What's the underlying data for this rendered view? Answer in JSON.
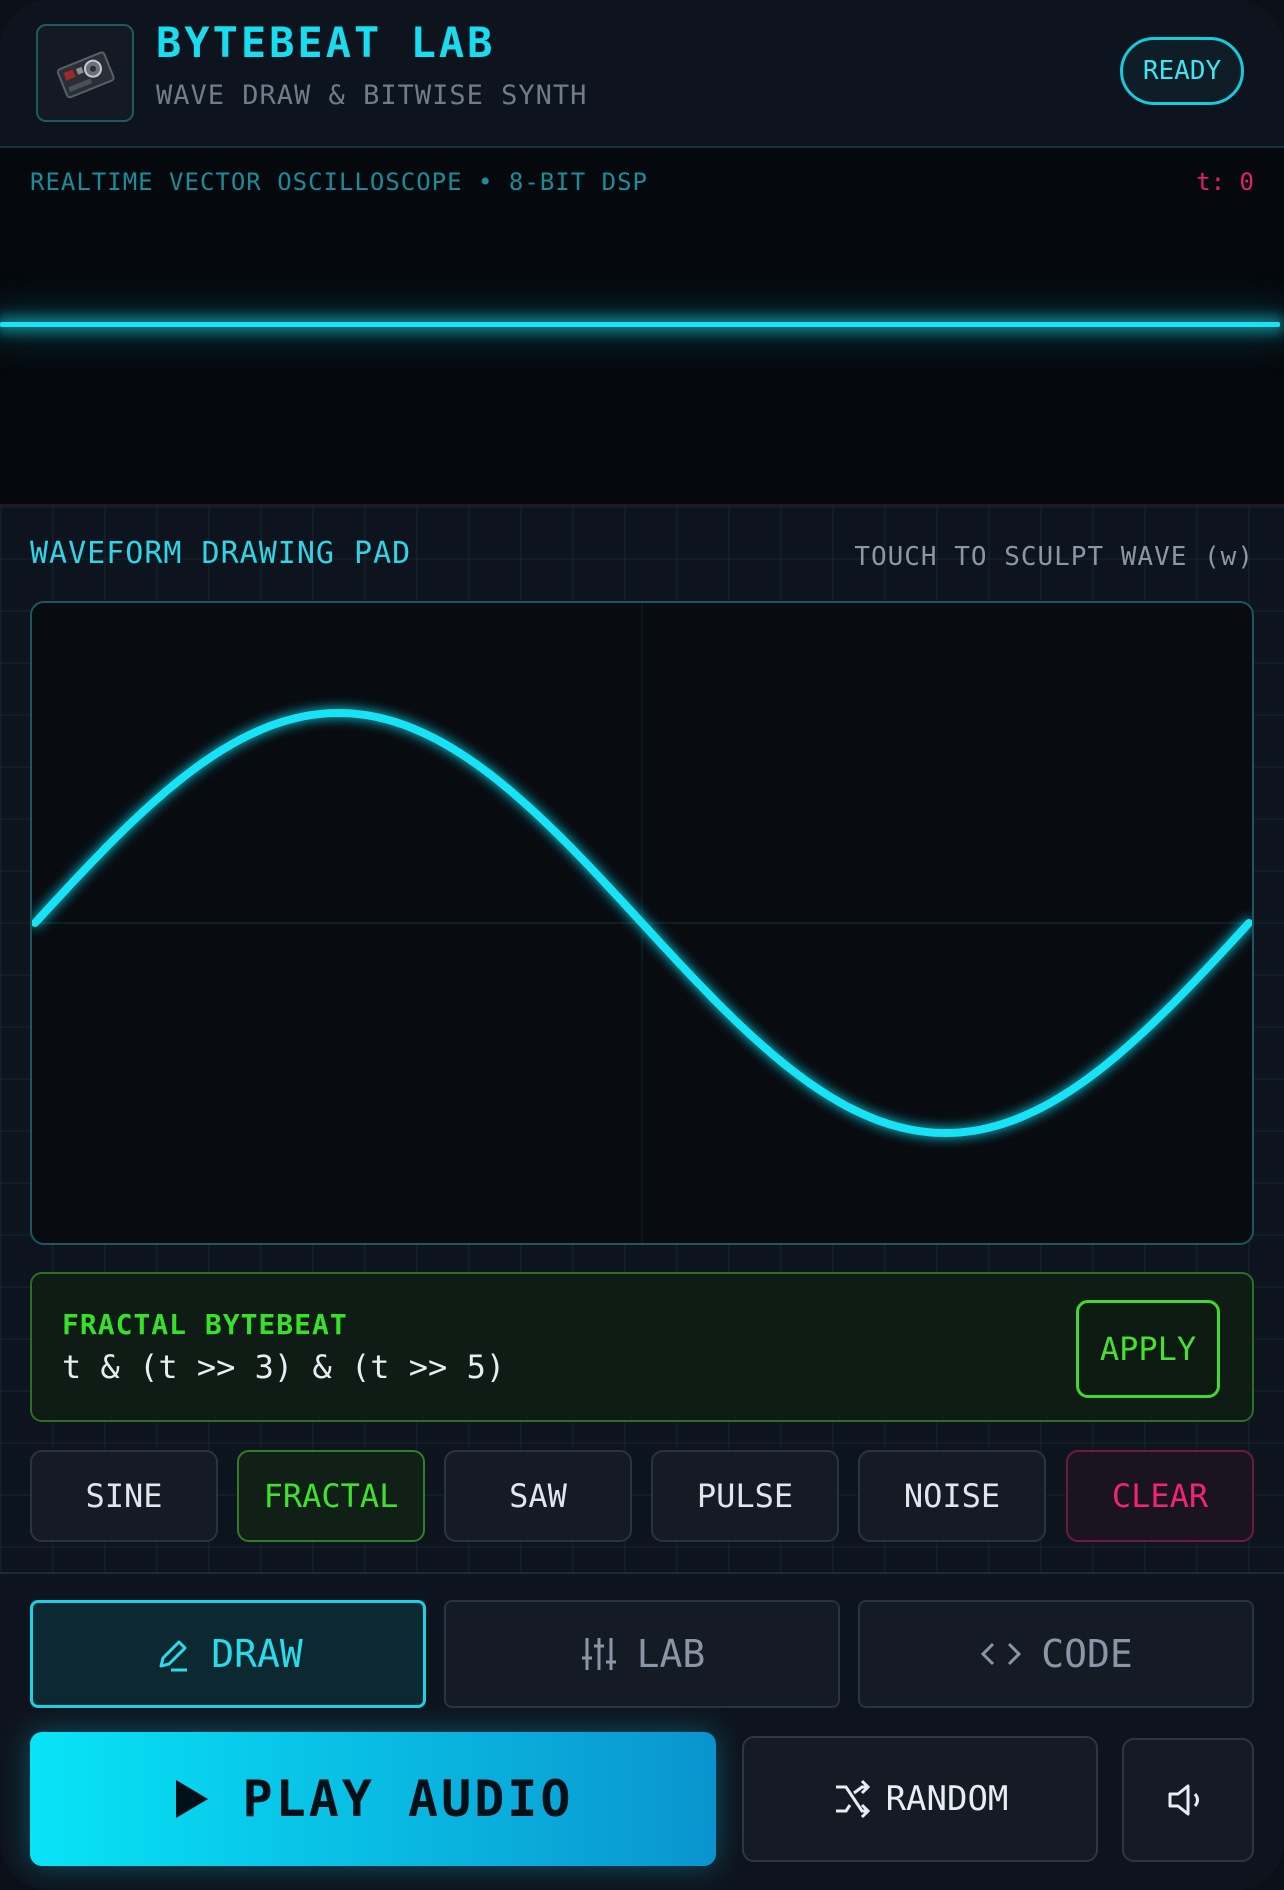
{
  "header": {
    "title": "BYTEBEAT LAB",
    "subtitle": "WAVE DRAW & BITWISE SYNTH",
    "status": "READY",
    "logo_icon": "circuit-board-icon"
  },
  "scope": {
    "label": "REALTIME VECTOR OSCILLOSCOPE • 8-BIT DSP",
    "time_readout": "t: 0"
  },
  "pad": {
    "label": "WAVEFORM DRAWING PAD",
    "hint": "TOUCH TO SCULPT WAVE (w)",
    "waveform": "sine",
    "color": "#19e3f5"
  },
  "formula": {
    "name": "FRACTAL BYTEBEAT",
    "expression": "t & (t >> 3) & (t >> 5)",
    "apply_label": "APPLY"
  },
  "presets": [
    {
      "label": "SINE",
      "state": "normal"
    },
    {
      "label": "FRACTAL",
      "state": "active"
    },
    {
      "label": "SAW",
      "state": "normal"
    },
    {
      "label": "PULSE",
      "state": "normal"
    },
    {
      "label": "NOISE",
      "state": "normal"
    },
    {
      "label": "CLEAR",
      "state": "danger"
    }
  ],
  "tabs": [
    {
      "label": "DRAW",
      "icon": "pencil-icon",
      "active": true
    },
    {
      "label": "LAB",
      "icon": "sliders-icon",
      "active": false
    },
    {
      "label": "CODE",
      "icon": "code-brackets-icon",
      "active": false
    }
  ],
  "actions": {
    "play_label": "PLAY AUDIO",
    "random_label": "RANDOM",
    "volume_icon": "speaker-low-icon"
  },
  "colors": {
    "accent_cyan": "#18dcef",
    "accent_green": "#3ee22e",
    "accent_pink": "#f0246f"
  }
}
